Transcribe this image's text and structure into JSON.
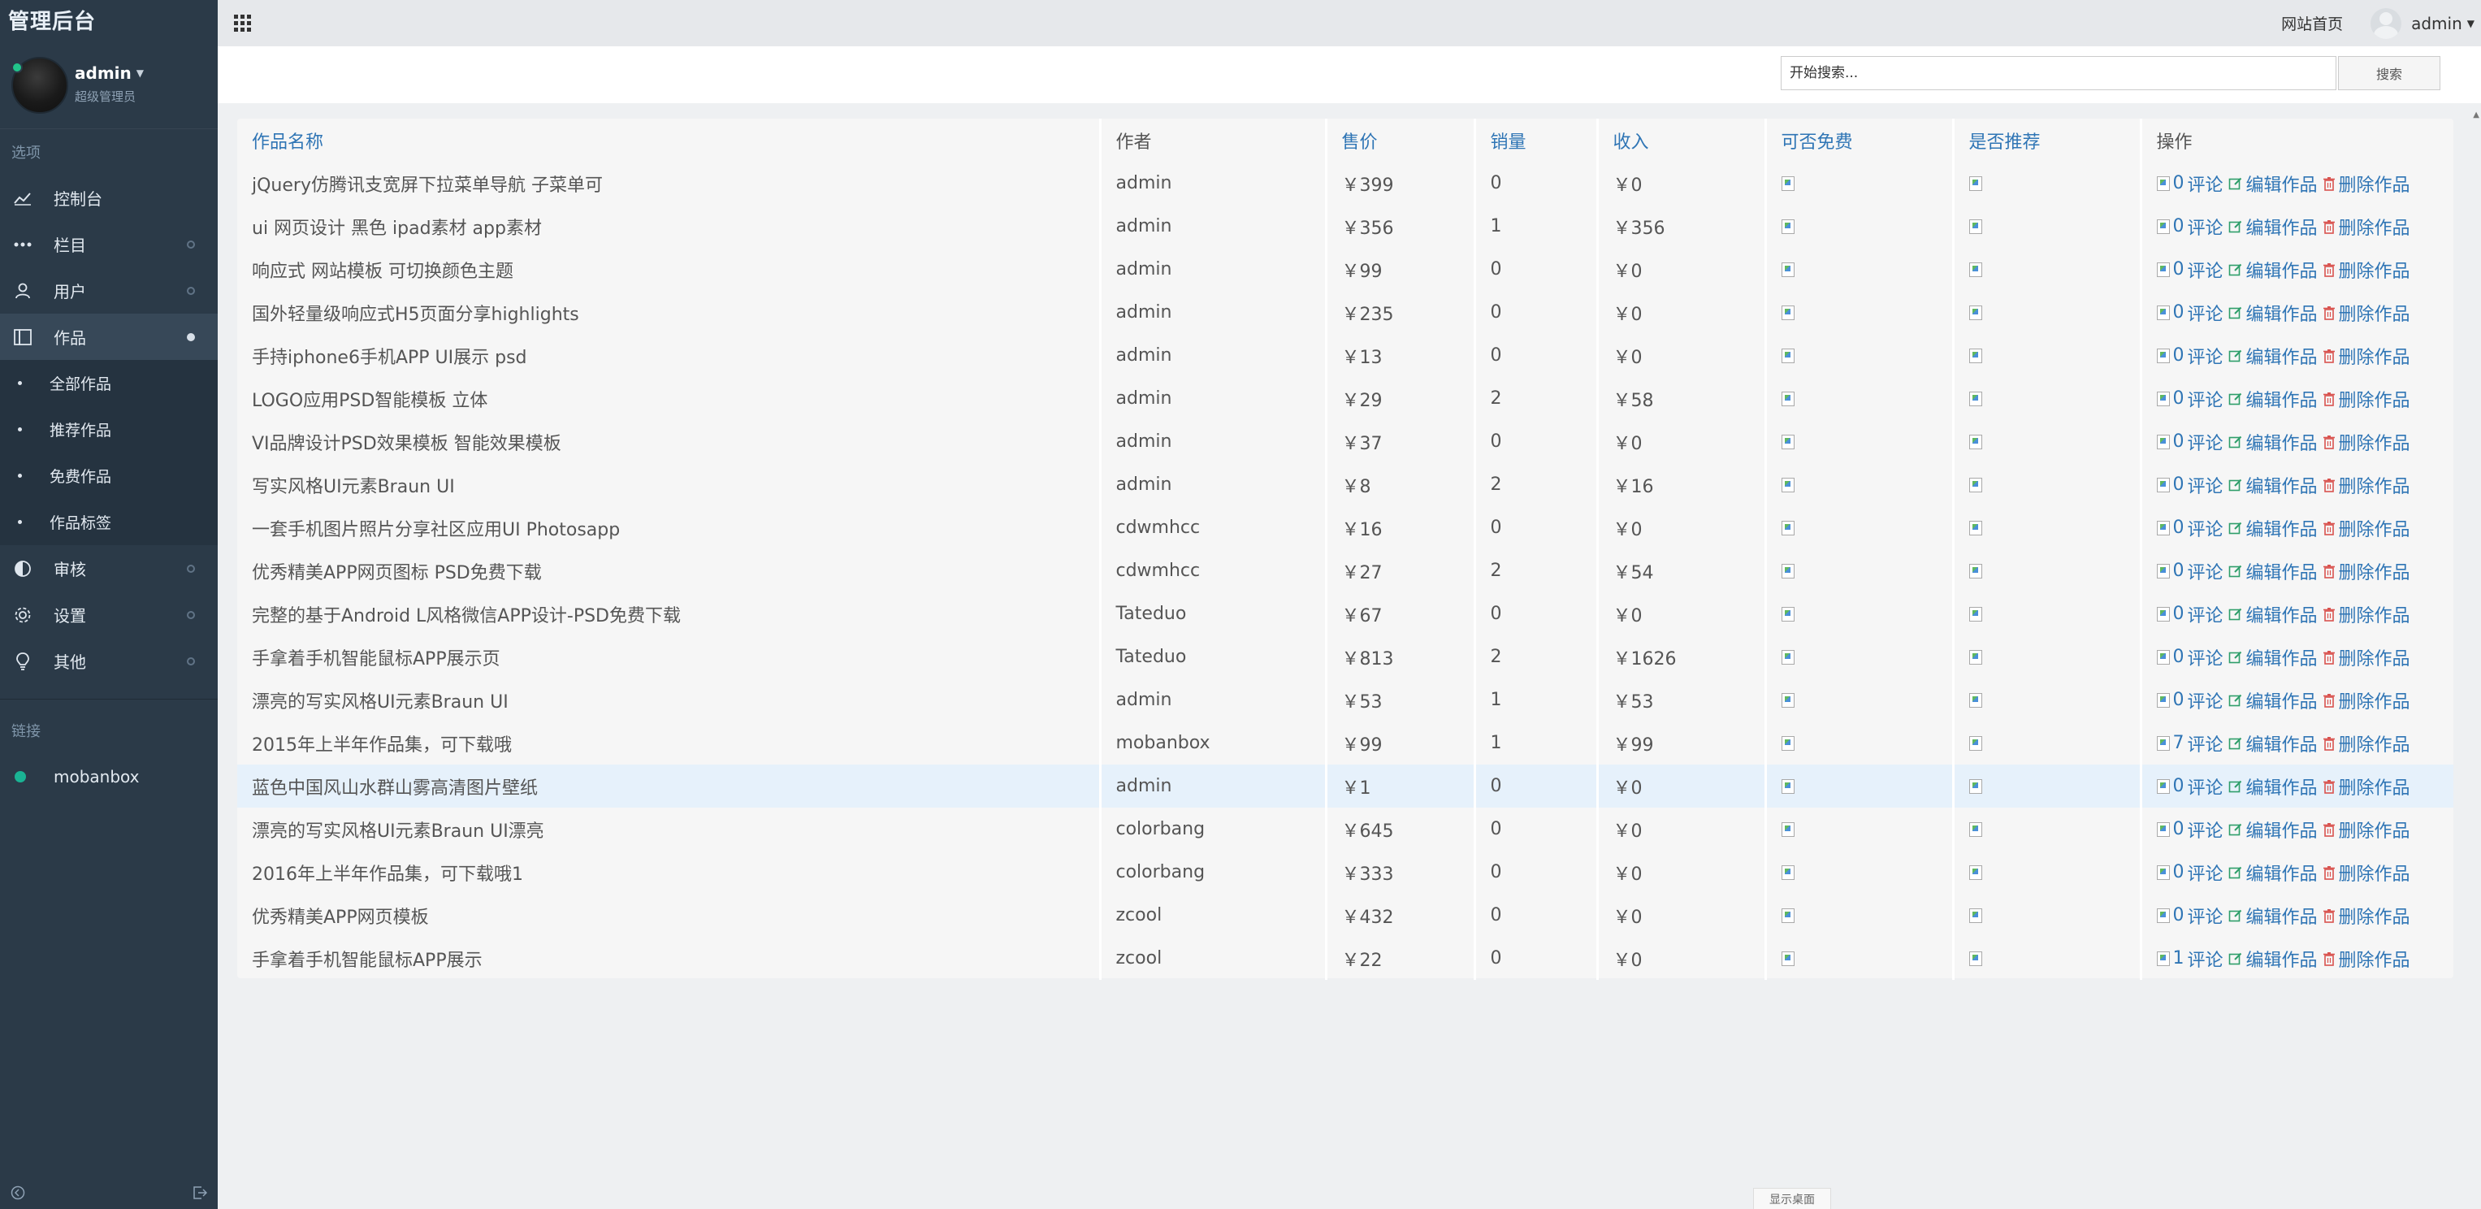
{
  "sidebar": {
    "brand": "管理后台",
    "profile": {
      "name": "admin",
      "role": "超级管理员"
    },
    "section_title": "选项",
    "menu": [
      {
        "label": "控制台",
        "icon": "chart-line-icon",
        "has_dot": false,
        "active": false
      },
      {
        "label": "栏目",
        "icon": "dots-icon",
        "has_dot": true,
        "active": false
      },
      {
        "label": "用户",
        "icon": "user-icon",
        "has_dot": true,
        "active": false
      },
      {
        "label": "作品",
        "icon": "book-icon",
        "has_dot": true,
        "active": true
      }
    ],
    "submenu": [
      {
        "label": "全部作品"
      },
      {
        "label": "推荐作品"
      },
      {
        "label": "免费作品"
      },
      {
        "label": "作品标签"
      }
    ],
    "menu_after": [
      {
        "label": "审核",
        "icon": "half-circle-icon"
      },
      {
        "label": "设置",
        "icon": "gear-icon"
      },
      {
        "label": "其他",
        "icon": "bulb-icon"
      }
    ],
    "links_title": "链接",
    "links": [
      {
        "label": "mobanbox",
        "color": "#1ab394"
      }
    ]
  },
  "topbar": {
    "site_home": "网站首页",
    "user": "admin"
  },
  "search": {
    "placeholder": "开始搜索...",
    "button": "搜索"
  },
  "table": {
    "headers": {
      "name": "作品名称",
      "author": "作者",
      "price": "售价",
      "sales": "销量",
      "income": "收入",
      "free": "可否免费",
      "recommend": "是否推荐",
      "ops": "操作"
    },
    "actions": {
      "comment": "评论",
      "edit": "编辑作品",
      "delete": "删除作品"
    },
    "rows": [
      {
        "name": "jQuery仿腾讯支宽屏下拉菜单导航 子菜单可",
        "author": "admin",
        "price": "￥399",
        "sales": "0",
        "income": "￥0",
        "comments": "0"
      },
      {
        "name": "ui 网页设计 黑色 ipad素材 app素材",
        "author": "admin",
        "price": "￥356",
        "sales": "1",
        "income": "￥356",
        "comments": "0"
      },
      {
        "name": "响应式 网站模板 可切换颜色主题",
        "author": "admin",
        "price": "￥99",
        "sales": "0",
        "income": "￥0",
        "comments": "0"
      },
      {
        "name": "国外轻量级响应式H5页面分享highlights",
        "author": "admin",
        "price": "￥235",
        "sales": "0",
        "income": "￥0",
        "comments": "0"
      },
      {
        "name": "手持iphone6手机APP UI展示 psd",
        "author": "admin",
        "price": "￥13",
        "sales": "0",
        "income": "￥0",
        "comments": "0"
      },
      {
        "name": "LOGO应用PSD智能模板 立体",
        "author": "admin",
        "price": "￥29",
        "sales": "2",
        "income": "￥58",
        "comments": "0"
      },
      {
        "name": "VI品牌设计PSD效果模板 智能效果模板",
        "author": "admin",
        "price": "￥37",
        "sales": "0",
        "income": "￥0",
        "comments": "0"
      },
      {
        "name": "写实风格UI元素Braun UI",
        "author": "admin",
        "price": "￥8",
        "sales": "2",
        "income": "￥16",
        "comments": "0"
      },
      {
        "name": "一套手机图片照片分享社区应用UI Photosapp",
        "author": "cdwmhcc",
        "price": "￥16",
        "sales": "0",
        "income": "￥0",
        "comments": "0"
      },
      {
        "name": "优秀精美APP网页图标 PSD免费下载",
        "author": "cdwmhcc",
        "price": "￥27",
        "sales": "2",
        "income": "￥54",
        "comments": "0"
      },
      {
        "name": "完整的基于Android L风格微信APP设计-PSD免费下载",
        "author": "Tateduo",
        "price": "￥67",
        "sales": "0",
        "income": "￥0",
        "comments": "0"
      },
      {
        "name": "手拿着手机智能鼠标APP展示页",
        "author": "Tateduo",
        "price": "￥813",
        "sales": "2",
        "income": "￥1626",
        "comments": "0"
      },
      {
        "name": "漂亮的写实风格UI元素Braun UI",
        "author": "admin",
        "price": "￥53",
        "sales": "1",
        "income": "￥53",
        "comments": "0"
      },
      {
        "name": "2015年上半年作品集，可下载哦",
        "author": "mobanbox",
        "price": "￥99",
        "sales": "1",
        "income": "￥99",
        "comments": "7"
      },
      {
        "name": "蓝色中国风山水群山雾高清图片壁纸",
        "author": "admin",
        "price": "￥1",
        "sales": "0",
        "income": "￥0",
        "comments": "0",
        "highlight": true
      },
      {
        "name": "漂亮的写实风格UI元素Braun UI漂亮",
        "author": "colorbang",
        "price": "￥645",
        "sales": "0",
        "income": "￥0",
        "comments": "0"
      },
      {
        "name": "2016年上半年作品集，可下载哦1",
        "author": "colorbang",
        "price": "￥333",
        "sales": "0",
        "income": "￥0",
        "comments": "0"
      },
      {
        "name": "优秀精美APP网页模板",
        "author": "zcool",
        "price": "￥432",
        "sales": "0",
        "income": "￥0",
        "comments": "0"
      },
      {
        "name": "手拿着手机智能鼠标APP展示",
        "author": "zcool",
        "price": "￥22",
        "sales": "0",
        "income": "￥0",
        "comments": "1"
      }
    ]
  },
  "footer": {
    "show_desktop": "显示桌面"
  },
  "colors": {
    "sidebar_bg": "#2b3a48",
    "link_blue": "#2f75b5",
    "delete_red": "#d9534f",
    "edit_green": "#2e9e6a",
    "online_green": "#21c48a"
  }
}
